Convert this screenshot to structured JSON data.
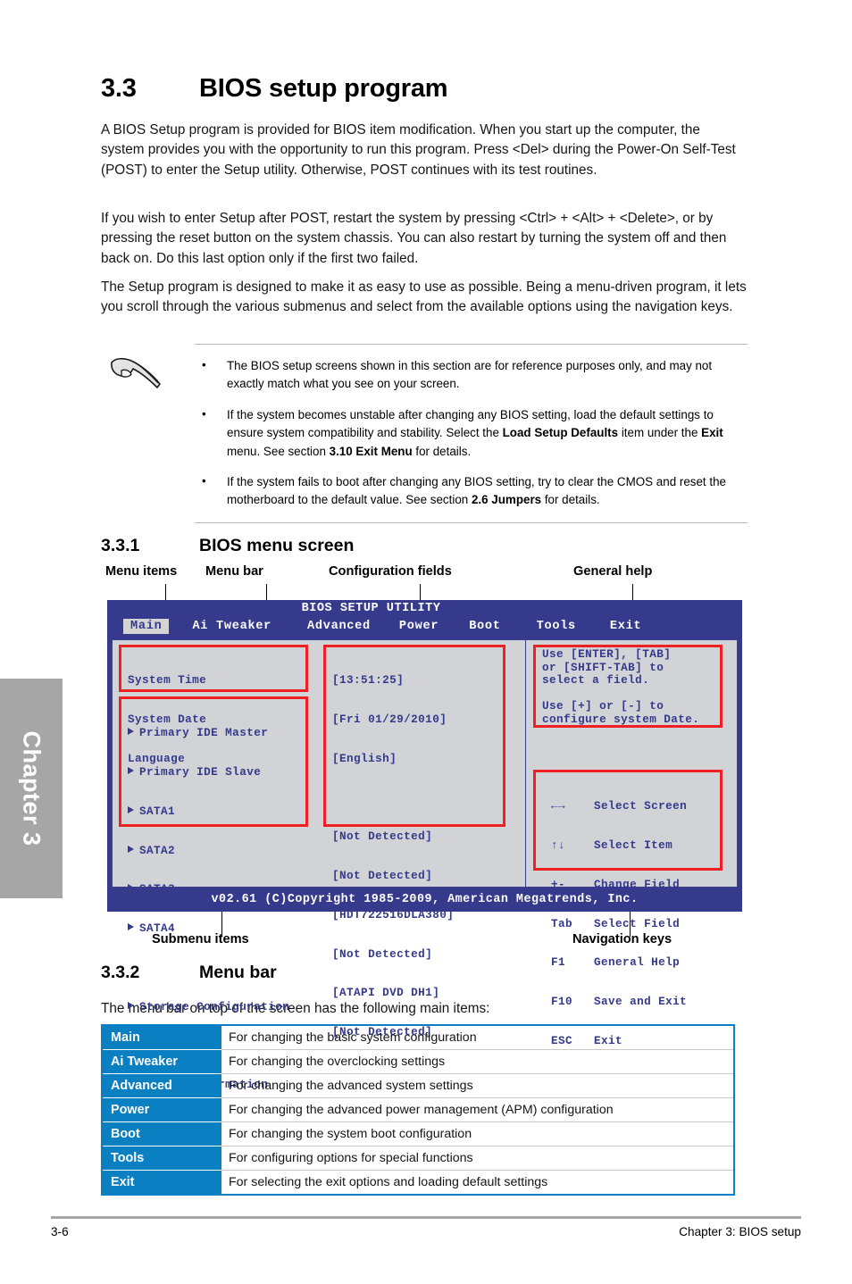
{
  "chapter_tab": {
    "label": "Chapter 3"
  },
  "section": {
    "number": "3.3",
    "title": "BIOS setup program",
    "paragraphs": [
      "A BIOS Setup program is provided for BIOS item modification. When you start up the computer, the system provides you with the opportunity to run this program. Press <Del> during the Power-On Self-Test (POST) to enter the Setup utility. Otherwise, POST continues with its test routines.",
      "If you wish to enter Setup after POST, restart the system by pressing <Ctrl> + <Alt> + <Delete>, or by pressing the reset button on the system chassis. You can also restart by turning the system off and then back on. Do this last option only if the first two failed.",
      "The Setup program is designed to make it as easy to use as possible. Being a menu-driven program, it lets you scroll through the various submenus and select from the available options using the navigation keys."
    ]
  },
  "note": {
    "icon": "pointing-hand-icon",
    "bullet_char": "•",
    "items": [
      {
        "parts": [
          {
            "text": "The BIOS setup screens shown in this section are for reference purposes only, and may not exactly match what you see on your screen.",
            "bold": false
          }
        ]
      },
      {
        "parts": [
          {
            "text": "If the system becomes unstable after changing any BIOS setting, load the default settings to ensure system compatibility and stability. Select the ",
            "bold": false
          },
          {
            "text": "Load Setup Defaults",
            "bold": true
          },
          {
            "text": " item under the ",
            "bold": false
          },
          {
            "text": "Exit",
            "bold": true
          },
          {
            "text": " menu. See section ",
            "bold": false
          },
          {
            "text": "3.10 Exit Menu",
            "bold": true
          },
          {
            "text": " for details.",
            "bold": false
          }
        ]
      },
      {
        "parts": [
          {
            "text": "If the system fails to boot after changing any BIOS setting, try to clear the CMOS and reset the motherboard to the default value. See section ",
            "bold": false
          },
          {
            "text": "2.6 Jumpers",
            "bold": true
          },
          {
            "text": " for details.",
            "bold": false
          }
        ]
      }
    ]
  },
  "subsection_331": {
    "number": "3.3.1",
    "title": "BIOS menu screen"
  },
  "callouts": {
    "menu_items": "Menu items",
    "menu_bar": "Menu bar",
    "configuration_fields": "Configuration fields",
    "general_help": "General help",
    "submenu_items": "Submenu items",
    "navigation_keys": "Navigation keys"
  },
  "bios": {
    "title": "BIOS SETUP UTILITY",
    "menu_tabs": [
      {
        "label": "Main",
        "active": true
      },
      {
        "label": "Ai Tweaker",
        "active": false
      },
      {
        "label": "Advanced",
        "active": false
      },
      {
        "label": "Power",
        "active": false
      },
      {
        "label": "Boot",
        "active": false
      },
      {
        "label": "Tools",
        "active": false
      },
      {
        "label": "Exit",
        "active": false
      }
    ],
    "menu_items_group1": [
      "System Time",
      "System Date",
      "Language"
    ],
    "submenu_items_group": [
      "Primary IDE Master",
      "Primary IDE Slave",
      "SATA1",
      "SATA2",
      "SATA3",
      "SATA4"
    ],
    "submenu_items_extra": [
      "Storage Configuration",
      "System Information"
    ],
    "config_fields_group1": [
      "[13:51:25]",
      "[Fri 01/29/2010]",
      "[English]"
    ],
    "config_fields_group2": [
      "[Not Detected]",
      "[Not Detected]",
      "[HDT722516DLA380]",
      "[Not Detected]",
      "[ATAPI DVD DH1]",
      "[Not Detected]"
    ],
    "general_help": "Use [ENTER], [TAB]\nor [SHIFT-TAB] to\nselect a field.\n\nUse [+] or [-] to\nconfigure system Date.",
    "navigation_keys": [
      {
        "key": "←→",
        "action": "Select Screen"
      },
      {
        "key": "↑↓",
        "action": "Select Item"
      },
      {
        "key": "+-",
        "action": "Change Field"
      },
      {
        "key": "Tab",
        "action": "Select Field"
      },
      {
        "key": "F1",
        "action": "General Help"
      },
      {
        "key": "F10",
        "action": "Save and Exit"
      },
      {
        "key": "ESC",
        "action": "Exit"
      }
    ],
    "footer": "v02.61 (C)Copyright 1985-2009, American Megatrends, Inc.",
    "colors": {
      "bar_blue": "#353a8c",
      "body_gray": "#d2d3d6",
      "highlight_red": "#ed2024"
    }
  },
  "subsection_332": {
    "number": "3.3.2",
    "title": "Menu bar",
    "intro": "The menu bar on top of the screen has the following main items:",
    "rows": [
      {
        "key": "Main",
        "desc": "For changing the basic system configuration"
      },
      {
        "key": "Ai Tweaker",
        "desc": "For changing the overclocking settings"
      },
      {
        "key": "Advanced",
        "desc": "For changing the advanced system settings"
      },
      {
        "key": "Power",
        "desc": "For changing the advanced power management (APM) configuration"
      },
      {
        "key": "Boot",
        "desc": "For changing the system boot configuration"
      },
      {
        "key": "Tools",
        "desc": "For configuring options for special functions"
      },
      {
        "key": "Exit",
        "desc": "For selecting the exit options and loading default settings"
      }
    ],
    "table_color": "#0a7fc2"
  },
  "footer": {
    "page_number": "3-6",
    "chapter_label": "Chapter 3: BIOS setup"
  }
}
